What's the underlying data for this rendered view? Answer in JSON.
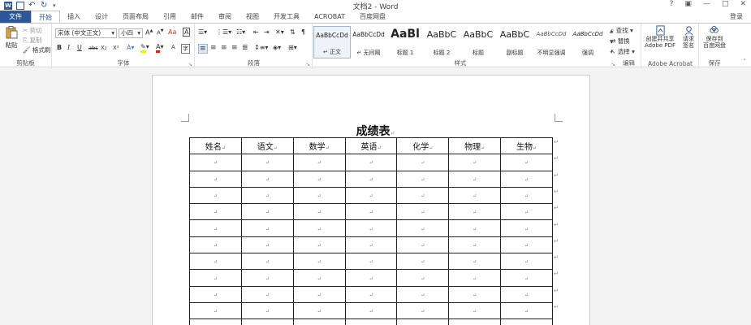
{
  "titlebar": {
    "app_title": "文档2 - Word",
    "help": "?",
    "ribbon_display": "▣",
    "minimize": "—",
    "maximize": "□",
    "close": "✕"
  },
  "tabs": [
    {
      "label": "文件"
    },
    {
      "label": "开始"
    },
    {
      "label": "插入"
    },
    {
      "label": "设计"
    },
    {
      "label": "页面布局"
    },
    {
      "label": "引用"
    },
    {
      "label": "邮件"
    },
    {
      "label": "审阅"
    },
    {
      "label": "视图"
    },
    {
      "label": "开发工具"
    },
    {
      "label": "ACROBAT"
    },
    {
      "label": "百度网盘"
    }
  ],
  "login_label": "登录",
  "clipboard": {
    "paste": "粘贴",
    "cut": "剪切",
    "copy": "复制",
    "format_painter": "格式刷",
    "group": "剪贴板"
  },
  "font": {
    "name": "宋体 (中文正文)",
    "size": "小四",
    "bold": "B",
    "italic": "I",
    "underline": "U",
    "strike": "abc",
    "subscript": "X₂",
    "superscript": "X²",
    "group": "字体"
  },
  "paragraph": {
    "group": "段落"
  },
  "styles": {
    "items": [
      {
        "sample": "AaBbCcDd",
        "name": "↵ 正文"
      },
      {
        "sample": "AaBbCcDd",
        "name": "↵ 无间隔"
      },
      {
        "sample": "AaBl",
        "name": "标题 1"
      },
      {
        "sample": "AaBbC",
        "name": "标题 2"
      },
      {
        "sample": "AaBbC",
        "name": "标题"
      },
      {
        "sample": "AaBbC",
        "name": "副标题"
      },
      {
        "sample": "AaBbCcDd",
        "name": "不明显强调"
      },
      {
        "sample": "AaBbCcDd",
        "name": "强调"
      }
    ],
    "group": "样式"
  },
  "editing": {
    "find": "查找",
    "replace": "替换",
    "select": "选择",
    "group": "编辑"
  },
  "acrobat": {
    "create_pdf_line1": "创建并共享",
    "create_pdf_line2": "Adobe PDF",
    "request_sign_line1": "请求",
    "request_sign_line2": "签名",
    "group": "Adobe Acrobat"
  },
  "save": {
    "save_to_line1": "保存到",
    "save_to_line2": "百度网盘",
    "group": "保存"
  },
  "document": {
    "title": "成绩表",
    "para_mark": "↵",
    "columns": [
      "姓名",
      "语文",
      "数学",
      "英语",
      "化学",
      "物理",
      "生物"
    ],
    "empty_rows": 11
  },
  "colors": {
    "accent": "#2b579a",
    "page_bg": "#f3f3f3"
  }
}
